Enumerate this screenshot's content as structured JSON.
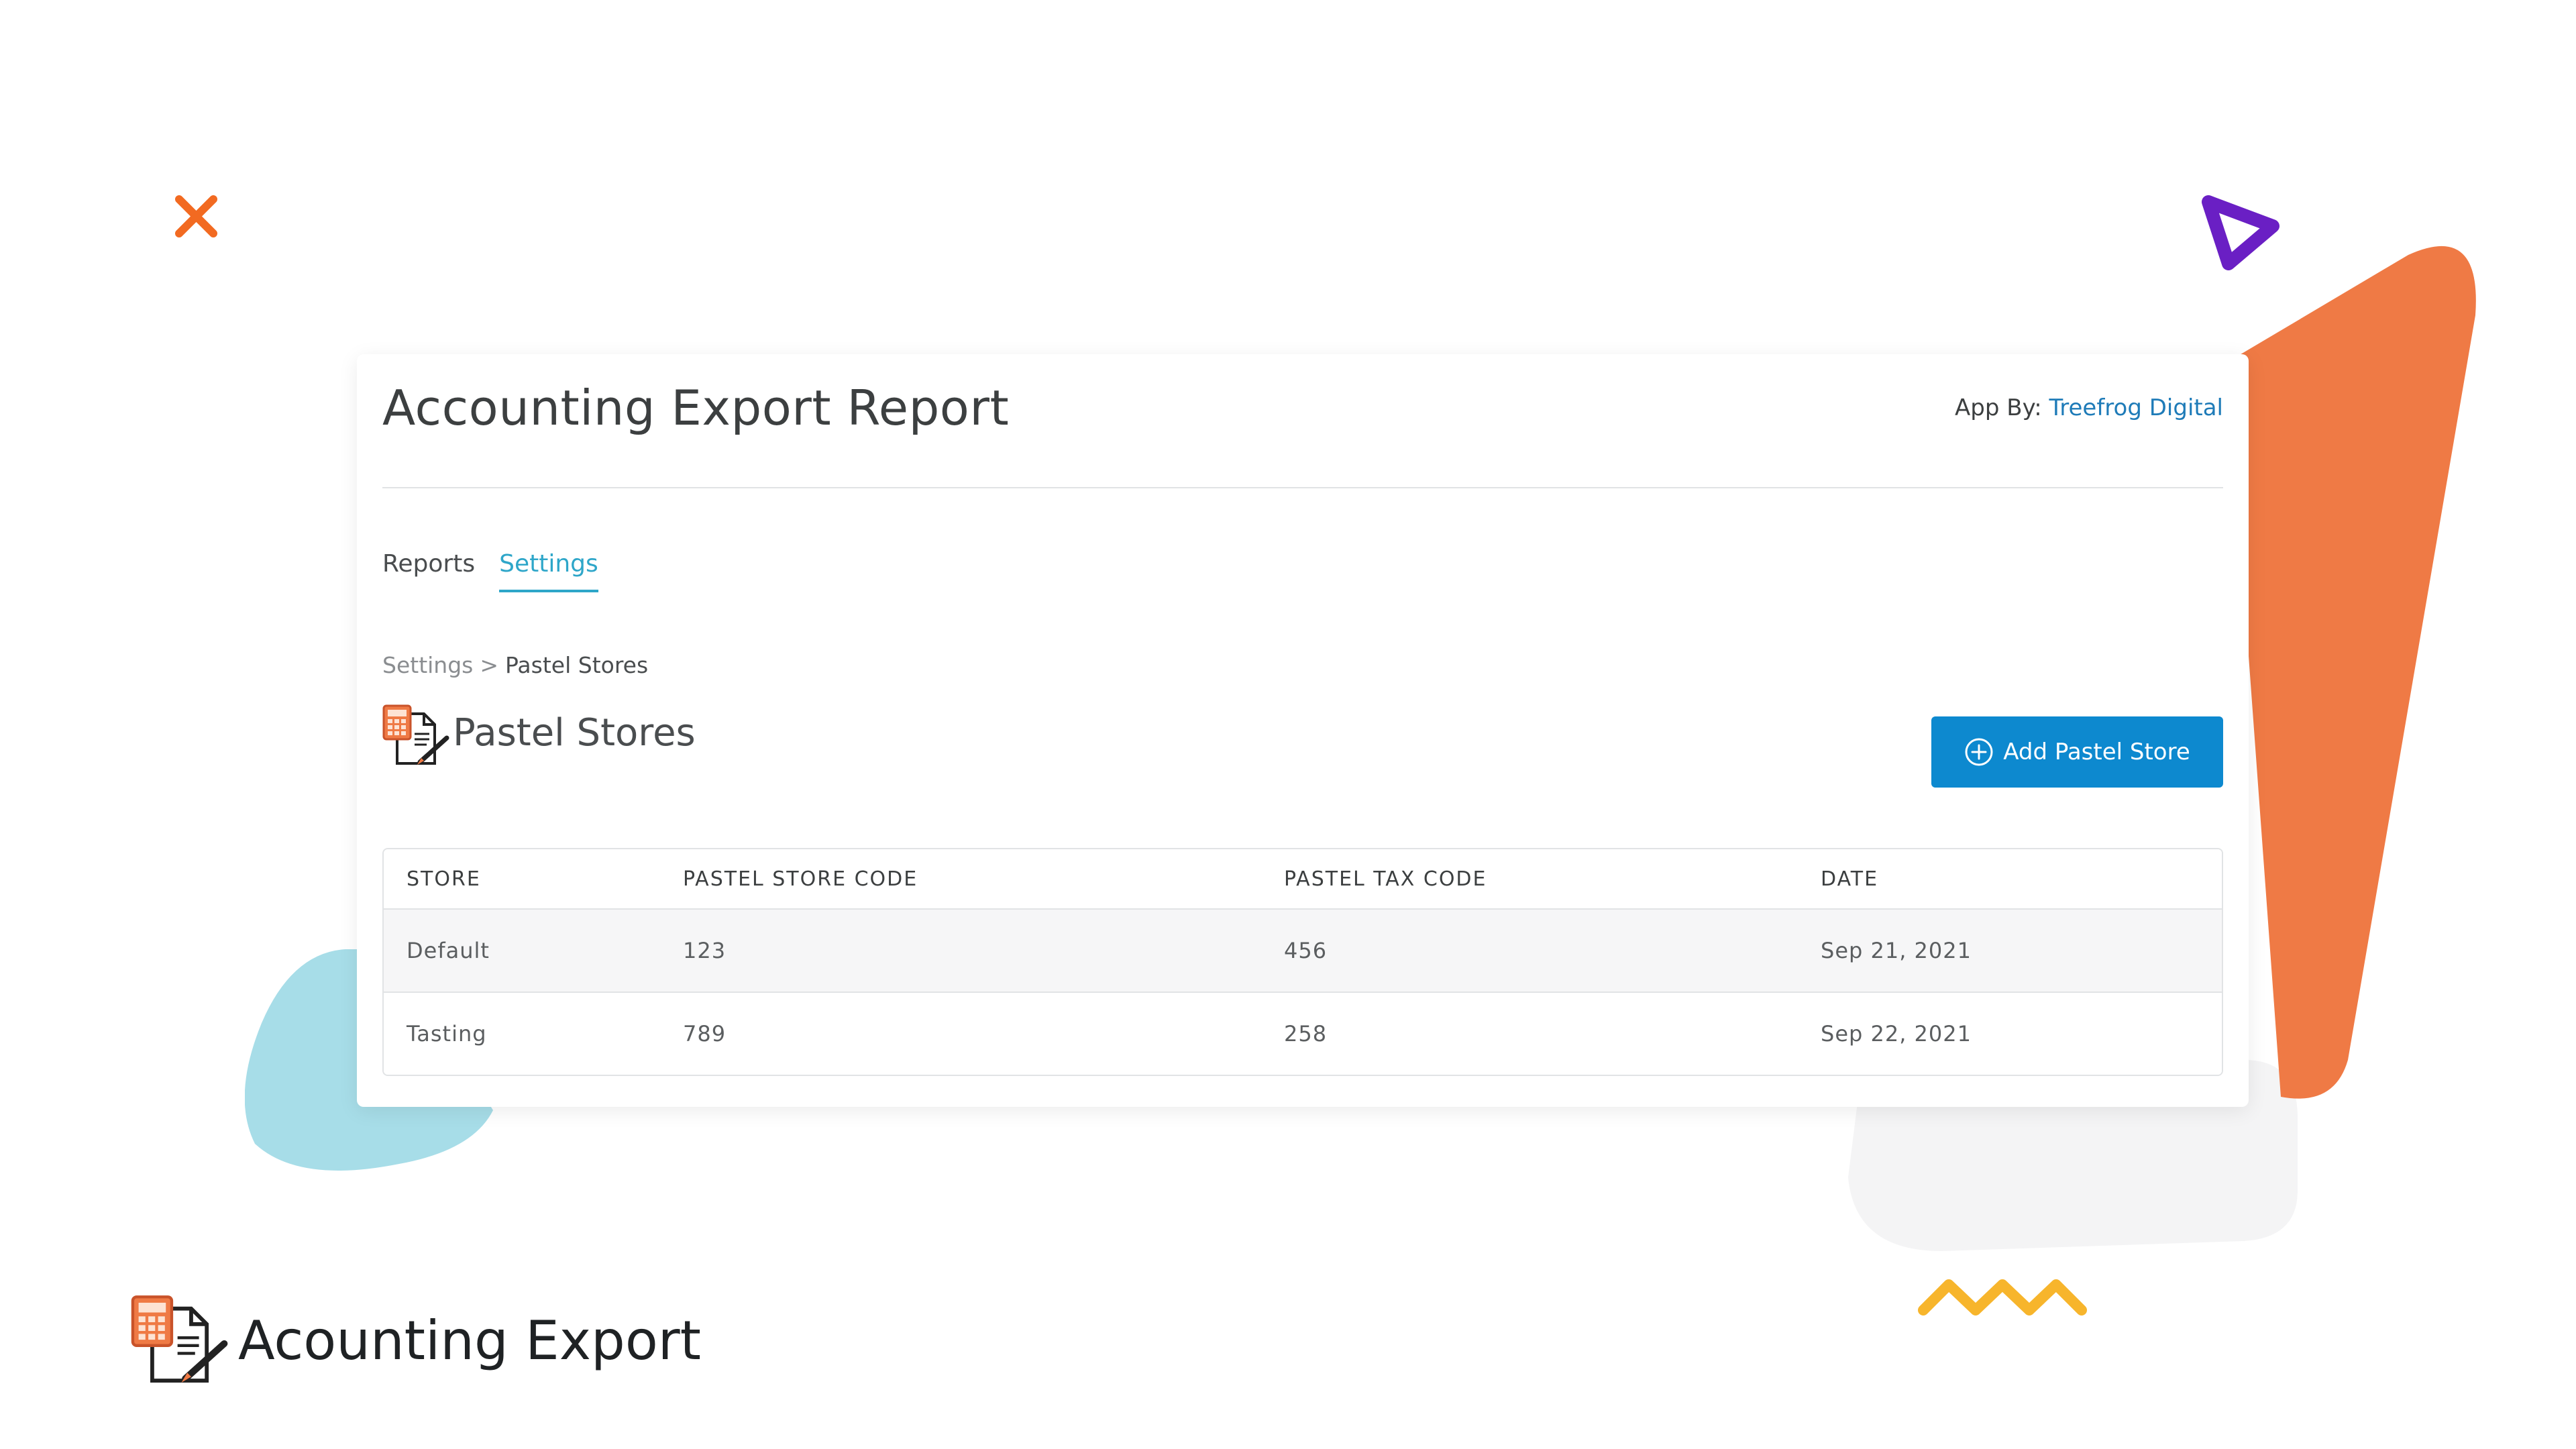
{
  "app": {
    "title": "Accounting Export Report",
    "credit_prefix": "App By:",
    "credit_link": "Treefrog Digital"
  },
  "tabs": [
    {
      "label": "Reports",
      "active": false
    },
    {
      "label": "Settings",
      "active": true
    }
  ],
  "breadcrumb": {
    "parent": "Settings",
    "separator": ">",
    "current": "Pastel Stores"
  },
  "section": {
    "icon": "accounting-document-icon",
    "title": "Pastel Stores",
    "add_button_icon": "plus-circle-icon",
    "add_button_label": "Add Pastel Store"
  },
  "table": {
    "headers": [
      "STORE",
      "PASTEL STORE CODE",
      "PASTEL TAX CODE",
      "DATE"
    ],
    "rows": [
      [
        "Default",
        "123",
        "456",
        "Sep 21, 2021"
      ],
      [
        "Tasting",
        "789",
        "258",
        "Sep 22, 2021"
      ]
    ]
  },
  "brand": {
    "icon": "accounting-document-icon",
    "name": "Acounting Export"
  },
  "colors": {
    "accent": "#2ea6c9",
    "button": "#0d89cf",
    "link": "#1e7bb8",
    "deco_orange": "#ef7a45",
    "deco_blue": "#a7dde8",
    "deco_purple": "#6a1fc4",
    "deco_yellow": "#f7b52c"
  }
}
